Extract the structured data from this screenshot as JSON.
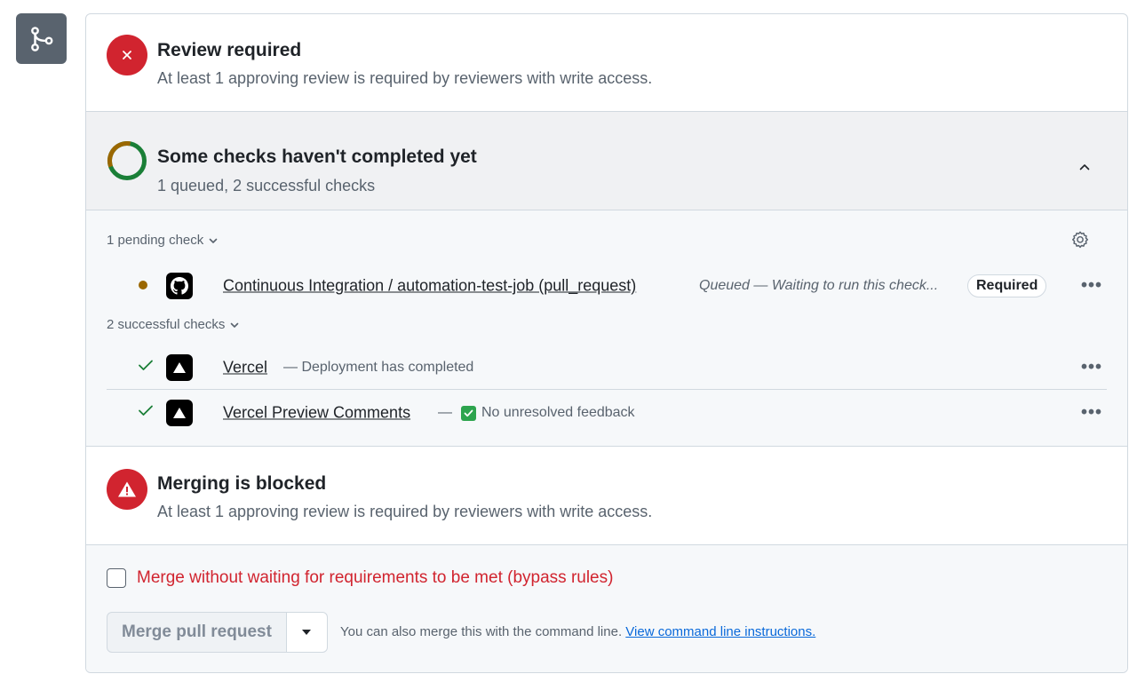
{
  "review": {
    "title": "Review required",
    "subtitle": "At least 1 approving review is required by reviewers with write access."
  },
  "checks": {
    "title": "Some checks haven't completed yet",
    "subtitle": "1 queued, 2 successful checks",
    "pending_group_label": "1 pending check",
    "successful_group_label": "2 successful checks",
    "pending": [
      {
        "name": "Continuous Integration / automation-test-job (pull_request)",
        "description": "Queued — Waiting to run this check...",
        "badge": "Required",
        "status": "queued"
      }
    ],
    "successful": [
      {
        "name": "Vercel",
        "description": "— Deployment has completed",
        "status": "success"
      },
      {
        "name": "Vercel Preview Comments",
        "description_prefix": "—",
        "description": "No unresolved feedback",
        "status": "success"
      }
    ]
  },
  "blocked": {
    "title": "Merging is blocked",
    "subtitle": "At least 1 approving review is required by reviewers with write access."
  },
  "merge": {
    "bypass_label": "Merge without waiting for requirements to be met (bypass rules)",
    "bypass_checked": false,
    "button_label": "Merge pull request",
    "cli_text": "You can also merge this with the command line.",
    "cli_link": "View command line instructions."
  },
  "colors": {
    "danger": "#d1242f",
    "success": "#1a7f37",
    "pending": "#9a6700",
    "link": "#0969da"
  }
}
